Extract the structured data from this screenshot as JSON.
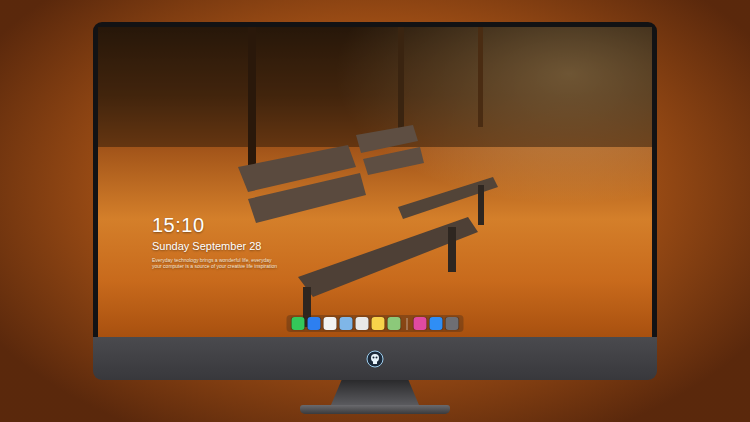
{
  "screen": {
    "clock": "15:10",
    "date": "Sunday September 28",
    "caption": [
      "Everyday technology brings a wonderful life, everyday",
      "your computer is a source of your creative life inspiration"
    ]
  },
  "dock": {
    "apps": [
      {
        "color": "#34c759"
      },
      {
        "color": "#2d7ff0"
      },
      {
        "color": "#f2f2f2"
      },
      {
        "color": "#7fb6e8"
      },
      {
        "color": "#e8e8e8"
      },
      {
        "color": "#f7d34a"
      },
      {
        "color": "#8cc97a"
      }
    ],
    "recent": [
      {
        "color": "#e04aa0"
      },
      {
        "color": "#2f8ef5"
      },
      {
        "color": "#6e6e73"
      }
    ]
  }
}
